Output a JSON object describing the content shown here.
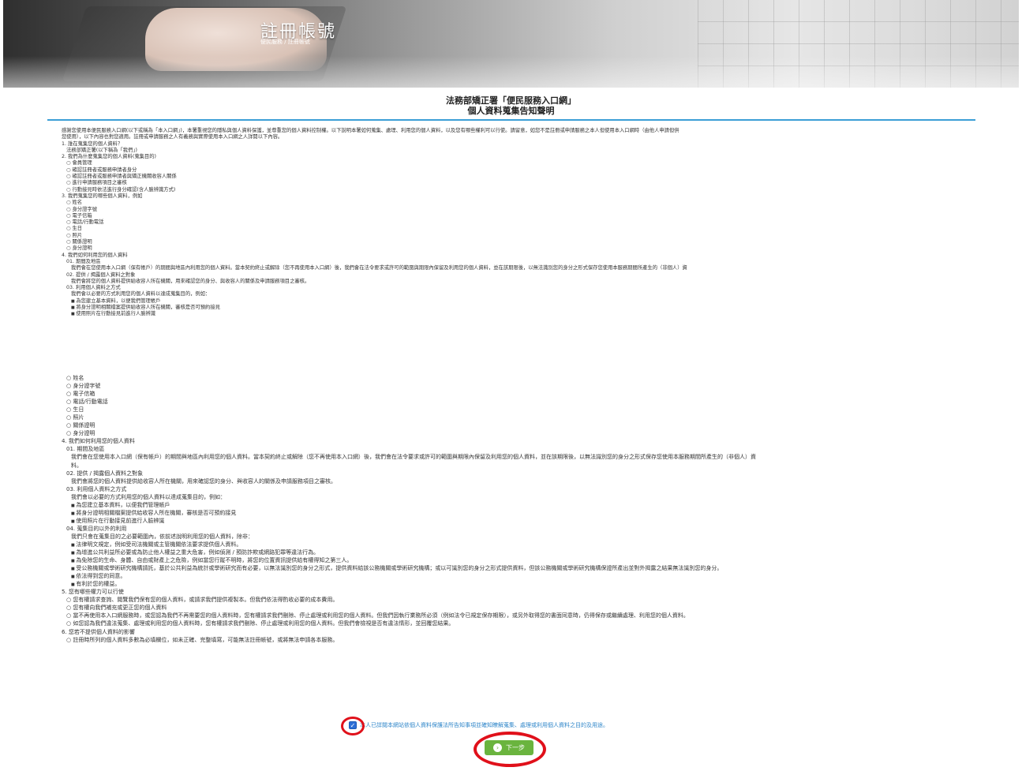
{
  "banner": {
    "title": "註冊帳號",
    "breadcrumb": "便民服務 / 註冊帳號"
  },
  "notice": {
    "title_line1": "法務部矯正署「便民服務入口網」",
    "title_line2": "個人資料蒐集告知聲明"
  },
  "section1": [
    "感謝您使用本便民服務入口網(以下或稱為「本入口網」)，本署重視您的隱私與個人資料保護，並尊重您的個人資料控制權。以下說明本署如何蒐集、處理、利用您的個人資料，以及您有哪些權利可以行使。請留意，如您不是註冊或申請服務之本人但使用本入口網時（由他人申請但供",
    "您使用），以下內容也對您適用。註冊或申請服務之人有義務與實際使用本入口網之人詳閱以下內容。",
    "1. 誰在蒐集您的個人資料？",
    "法務部矯正署(以下稱為「我們」)",
    "2. 我們為什麼蒐集您的個人資料(蒐集目的)",
    "會員管理",
    "確認註冊者或服務申請者身分",
    "確認註冊者或服務申請者與矯正機關收容人關係",
    "進行申請服務項目之審核",
    "行動接見時依法進行身分確認(含人臉辨識方式)",
    "3. 我們蒐集您的哪些個人資料，例如",
    "姓名",
    "身分證字號",
    "電子信箱",
    "電話/行動電話",
    "生日",
    "照片",
    "關係證明",
    "身分證明",
    "4. 我們如何利用您的個人資料",
    "01. 期間及地區",
    "我們會在您使用本入口網（保有帳戶）的期間與地區內利用您的個人資料。當本契約終止或解除（您不再使用本入口網）後，我們會在法令要求或許可的範圍與期限內保留及利用您的個人資料，並在該期限後，以無法識別您的身分之形式保存您使用本服務期間所產生的（非個人）資",
    "02. 提供 / 揭露個人資料之對象",
    "我們會將您的個人資料提供給收容人所在機關，用來確認您的身分、與收容人的關係及申請服務項目之審核。",
    "03. 利用個人資料之方式",
    "我們會以必要的方式利用您的個人資料以達成蒐集目的，例如：",
    "為您建立基本資料，以便我們管理帳戶",
    "將身分證明相關檔案提供給收容人所在機關，審核是否可預約接見",
    "使用照片在行動接見前進行人臉辨識"
  ],
  "section2": [
    "姓名",
    "身分證字號",
    "電子信箱",
    "電話/行動電話",
    "生日",
    "照片",
    "關係證明",
    "身分證明",
    "4. 我們如何利用您的個人資料",
    "01. 期間及地區",
    "我們會在您使用本入口網（保有帳戶）的期間與地區內利用您的個人資料。當本契約終止或解除（您不再使用本入口網）後，我們會在法令要求或許可的範圍與期限內保留及利用您的個人資料，並在該期限後，以無法識別您的身分之形式保存您使用本服務期間所產生的（非個人）資",
    "料。",
    "02. 提供 / 揭露個人資料之對象",
    "我們會將您的個人資料提供給收容人所在機關，用來確認您的身分、與收容人的關係及申請服務項目之審核。",
    "03. 利用個人資料之方式",
    "我們會以必要的方式利用您的個人資料以達成蒐集目的，例如：",
    "為您建立基本資料，以便我們管理帳戶",
    "將身分證明相關檔案提供給收容人所在機關，審核是否可預約接見",
    "使用照片在行動接見前進行人臉辨識",
    "04. 蒐集目的以外的利用",
    "我們只會在蒐集目的之必要範圍內，依前述說明利用您的個人資料，除非：",
    "法律明文規定，例如受司法機關或主管機關依法要求提供個人資料。",
    "為增進公共利益所必要或為防止他人權益之重大危害，例如偵測 / 預防詐欺或網路犯罪等違法行為。",
    "為免除您的生命、身體、自由或財產上之危險，例如當您行蹤不明時，將您的位置資訊提供給有權得知之第三人。",
    "受公務機關或學術研究機構請託，基於公共利益為統計或學術研究而有必要，以無法識別您的身分之形式，提供資料給該公務機關或學術研究機構；或以可識別您的身分之形式提供資料，但該公務機關或學術研究機構保證所產出並對外揭露之結果無法識別您的身分。",
    "依法得到您的同意。",
    "有利於您的權益。",
    "5. 您有哪些權力可以行使",
    "您有權請求查詢、閱覽我們保有您的個人資料，或請求我們提供複製本。但我們依法得酌收必要的成本費用。",
    "您有權向我們補充或更正您的個人資料",
    "當不再使用本入口網服務時，或您認為我們不再需要您的個人資料時，您有權請求我們刪除、停止處理或利用您的個人資料。但我們因執行業務所必須（例如法令已規定保存期限），或另外取得您的書面同意時，仍得保存或繼續處理、利用您的個人資料。",
    "如您認為我們違法蒐集、處理或利用您的個人資料時，您有權請求我們刪除、停止處理或利用您的個人資料。但我們會檢視是否有違法情形，並回覆您結果。",
    "6. 您若不提供個人資料的影響",
    "註冊時所列的個人資料多數為必填欄位，如未正確、完整填寫，可能無法註冊帳號，或將無法申請各本服務。"
  ],
  "agreement": {
    "checked": true,
    "text": "本人已詳閱本網站依個人資料保護法所告知事項並確知瞭解蒐集、處理或利用個人資料之目的及用途。"
  },
  "next_button": {
    "label": "下一步"
  },
  "colors": {
    "accent_rule": "#3b9fd6",
    "button_green": "#6ab43e",
    "highlight_red": "#e0101a",
    "link_blue": "#2f86c9"
  }
}
